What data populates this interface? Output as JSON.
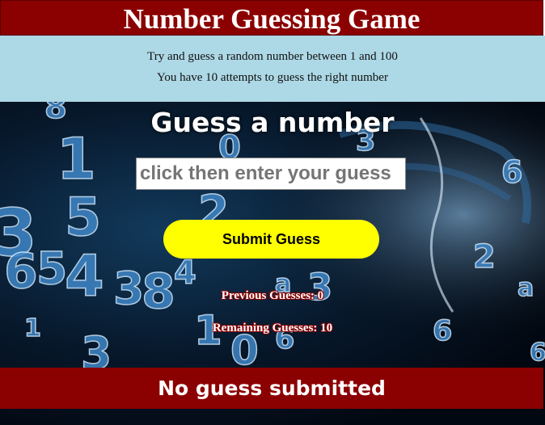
{
  "header": {
    "title": "Number Guessing Game"
  },
  "instructions": {
    "line1": "Try and guess a random number between 1 and 100",
    "line2": "You have 10 attempts to guess the right number"
  },
  "game": {
    "heading": "Guess a number",
    "input_placeholder": "click then enter your guess",
    "input_value": "",
    "submit_label": "Submit Guess",
    "previous_guesses": "Previous Guesses: 0",
    "remaining_guesses": "Remaining Guesses: 10",
    "result_message": "No guess submitted"
  },
  "colors": {
    "header_bg": "#8b0000",
    "instructions_bg": "#add8e6",
    "button_bg": "#ffff00",
    "result_bg": "#8b0000"
  }
}
